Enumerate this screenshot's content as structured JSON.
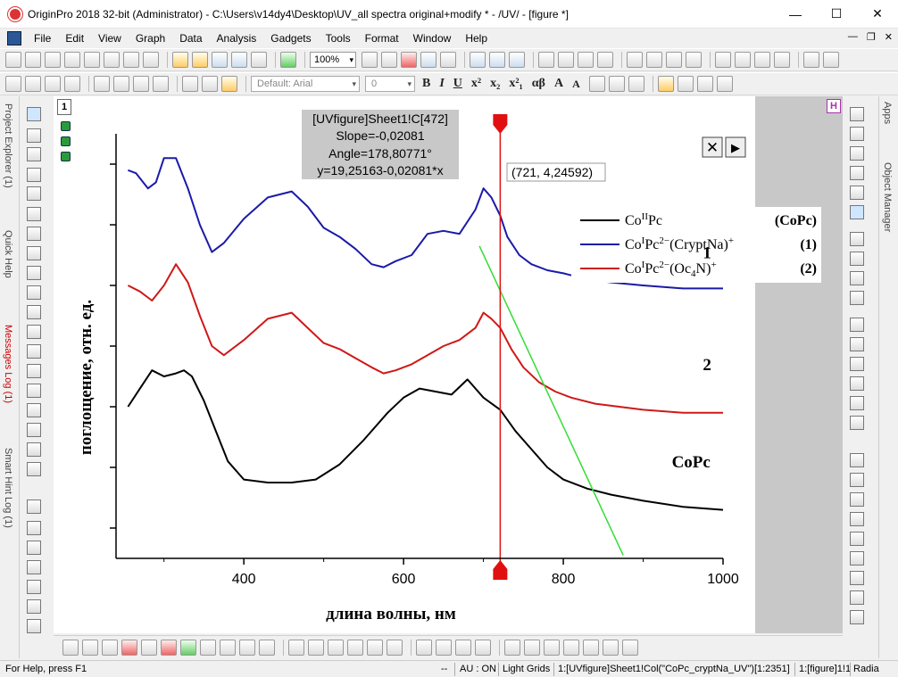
{
  "window": {
    "title": "OriginPro 2018 32-bit (Administrator) - C:\\Users\\v14dy4\\Desktop\\UV_all spectra original+modify * - /UV/ - [figure *]"
  },
  "menu": [
    "File",
    "Edit",
    "View",
    "Graph",
    "Data",
    "Analysis",
    "Gadgets",
    "Tools",
    "Format",
    "Window",
    "Help"
  ],
  "toolbar": {
    "zoom": "100%",
    "font": "Default: Arial",
    "font_size": "0"
  },
  "format_buttons": [
    "B",
    "I",
    "U",
    "x²",
    "x₂",
    "x²₁",
    "αβ",
    "A",
    "A"
  ],
  "side_tabs_left": [
    "Project Explorer (1)",
    "Quick Help",
    "Messages Log (1)",
    "Smart Hint Log (1)"
  ],
  "side_tabs_right": [
    "Apps",
    "Object Manager"
  ],
  "layer_label": "1",
  "h_button": "H",
  "info_box": [
    "[UVfigure]Sheet1!C[472]",
    "Slope=-0,02081",
    "Angle=178,80771°",
    "y=19,25163-0,02081*x"
  ],
  "cursor_readout": "(721, 4,24592)",
  "close_symbol": "✕",
  "play_symbol": "▶",
  "status": {
    "help": "For Help, press F1",
    "dashes": "--",
    "au": "AU : ON",
    "theme": "Light Grids",
    "col": "1:[UVfigure]Sheet1!Col(\"CoPc_cryptNa_UV\")[1:2351]",
    "layer": "1:[figure]1!1",
    "angle": "Radia"
  },
  "colors": {
    "black": "#000000",
    "blue": "#1a1aa8",
    "red": "#d01818",
    "green": "#33dd33",
    "cursor": "#e01010"
  },
  "chart_data": {
    "type": "line",
    "xlabel": "длина волны, нм",
    "ylabel": "поглощение, отн. ед.",
    "xlim": [
      240,
      1000
    ],
    "ylim": [
      0,
      7
    ],
    "xticks": [
      400,
      600,
      800,
      1000
    ],
    "y_tick_labels": false,
    "grid": false,
    "legend_position": "top-right",
    "legend": [
      {
        "pre": "Co",
        "sup1": "II",
        "mid": "Pc",
        "sup2": "",
        "post": "",
        "sup3": "",
        "tag": "(CoPc)",
        "color": "#000000"
      },
      {
        "pre": "Co",
        "sup1": "I",
        "mid": "Pc",
        "sup2": "2−",
        "post": "(CryptNa)",
        "sup3": "+",
        "tag": "(1)",
        "color": "#1a1aa8"
      },
      {
        "pre": "Co",
        "sup1": "I",
        "mid": "Pc",
        "sup2": "2−",
        "post": "(Oc",
        "sub": "4",
        "post2": "N)",
        "sup3": "+",
        "tag": "(2)",
        "color": "#d01818"
      }
    ],
    "annotations": [
      {
        "text": "1",
        "x": 980,
        "y": 4.95
      },
      {
        "text": "2",
        "x": 980,
        "y": 3.1
      },
      {
        "text": "CoPc",
        "x": 960,
        "y": 1.5
      }
    ],
    "series": [
      {
        "name": "CoPc",
        "color": "#000000",
        "x": [
          255,
          270,
          285,
          300,
          315,
          325,
          335,
          350,
          365,
          380,
          400,
          430,
          460,
          490,
          520,
          550,
          580,
          600,
          620,
          640,
          660,
          680,
          700,
          721,
          740,
          760,
          780,
          800,
          830,
          860,
          900,
          950,
          1000
        ],
        "y": [
          2.5,
          2.8,
          3.1,
          3.0,
          3.05,
          3.1,
          3.0,
          2.6,
          2.1,
          1.6,
          1.3,
          1.25,
          1.25,
          1.3,
          1.55,
          1.95,
          2.4,
          2.65,
          2.8,
          2.75,
          2.7,
          2.95,
          2.65,
          2.45,
          2.1,
          1.8,
          1.5,
          1.3,
          1.15,
          1.05,
          0.95,
          0.85,
          0.8
        ]
      },
      {
        "name": "(1)",
        "color": "#1a1aa8",
        "x": [
          255,
          265,
          280,
          290,
          300,
          315,
          330,
          345,
          360,
          375,
          400,
          430,
          460,
          480,
          500,
          520,
          540,
          560,
          575,
          590,
          610,
          630,
          650,
          670,
          690,
          700,
          710,
          721,
          730,
          745,
          760,
          780,
          800,
          830,
          860,
          900,
          950,
          1000
        ],
        "y": [
          6.4,
          6.35,
          6.1,
          6.2,
          6.6,
          6.6,
          6.1,
          5.5,
          5.05,
          5.2,
          5.6,
          5.95,
          6.05,
          5.8,
          5.45,
          5.3,
          5.1,
          4.85,
          4.8,
          4.9,
          5.0,
          5.35,
          5.4,
          5.35,
          5.75,
          6.1,
          5.95,
          5.65,
          5.3,
          5.0,
          4.85,
          4.75,
          4.7,
          4.6,
          4.55,
          4.5,
          4.45,
          4.45
        ]
      },
      {
        "name": "(2)",
        "color": "#d01818",
        "x": [
          255,
          270,
          285,
          300,
          315,
          330,
          345,
          360,
          375,
          400,
          430,
          460,
          480,
          500,
          520,
          540,
          560,
          575,
          590,
          610,
          630,
          650,
          670,
          690,
          700,
          710,
          721,
          735,
          750,
          770,
          790,
          810,
          840,
          870,
          900,
          950,
          1000
        ],
        "y": [
          4.5,
          4.4,
          4.25,
          4.5,
          4.85,
          4.55,
          4.0,
          3.5,
          3.35,
          3.6,
          3.95,
          4.05,
          3.8,
          3.55,
          3.45,
          3.3,
          3.15,
          3.05,
          3.1,
          3.2,
          3.35,
          3.5,
          3.6,
          3.8,
          4.05,
          3.95,
          3.8,
          3.45,
          3.15,
          2.9,
          2.75,
          2.65,
          2.55,
          2.5,
          2.45,
          2.4,
          2.4
        ]
      }
    ],
    "tangent_line": {
      "x": [
        695,
        875
      ],
      "y": [
        5.15,
        0.05
      ],
      "color": "#33dd33"
    },
    "vertical_cursor": {
      "x": 721,
      "color": "#e01010"
    }
  }
}
